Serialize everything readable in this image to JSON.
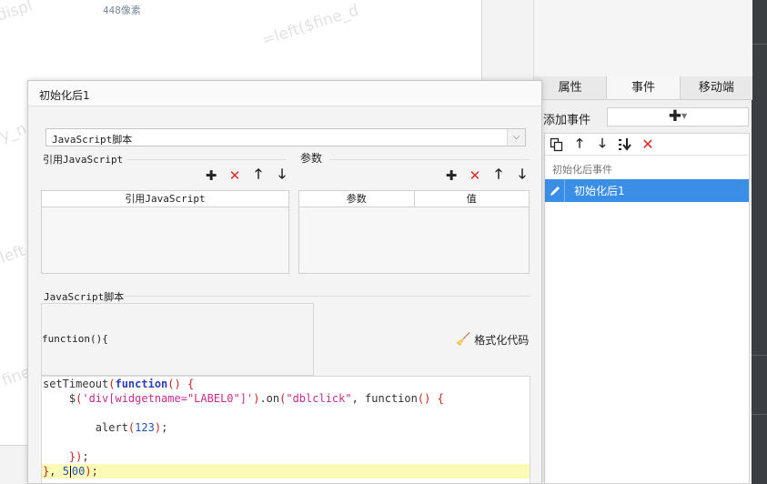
{
  "background": {
    "pixel_label": "448像素",
    "watermarks": [
      "=left($fine_d",
      "displ",
      "y_n",
      "left",
      "fine"
    ]
  },
  "right_panel": {
    "tabs": [
      {
        "label": "属性",
        "active": false
      },
      {
        "label": "事件",
        "active": true
      },
      {
        "label": "移动端",
        "active": false
      }
    ],
    "add_event_label": "添加事件",
    "add_button_icon": "plus-dropdown-icon",
    "toolbar_icons": [
      "copy-icon",
      "arrow-up-icon",
      "arrow-down-icon",
      "move-bottom-icon",
      "delete-icon"
    ],
    "group_label": "初始化后事件",
    "events": [
      {
        "label": "初始化后1",
        "selected": true,
        "icon": "pencil-icon"
      }
    ]
  },
  "dialog": {
    "title": "初始化后1",
    "type_select_value": "JavaScript脚本",
    "ref_js_section": "引用JavaScript",
    "params_section": "参数",
    "ref_js_table_headers": [
      "引用JavaScript"
    ],
    "params_table_headers": [
      "参数",
      "值"
    ],
    "script_section": "JavaScript脚本",
    "function_signature": "function(){",
    "format_button_label": "格式化代码",
    "code_lines": [
      "setTimeout(function() {",
      "    $('div[widgetname=\"LABEL0\"]').on(\"dblclick\", function() {",
      "",
      "        alert(123);",
      "",
      "    });",
      "}, 500);"
    ],
    "highlighted_line": 7
  },
  "colors": {
    "selection_blue": "#3a8ee6",
    "delete_red": "#e02828",
    "code_keyword": "#2a3fb8",
    "code_string": "#c92c8e",
    "current_line": "#fbfbb7"
  }
}
